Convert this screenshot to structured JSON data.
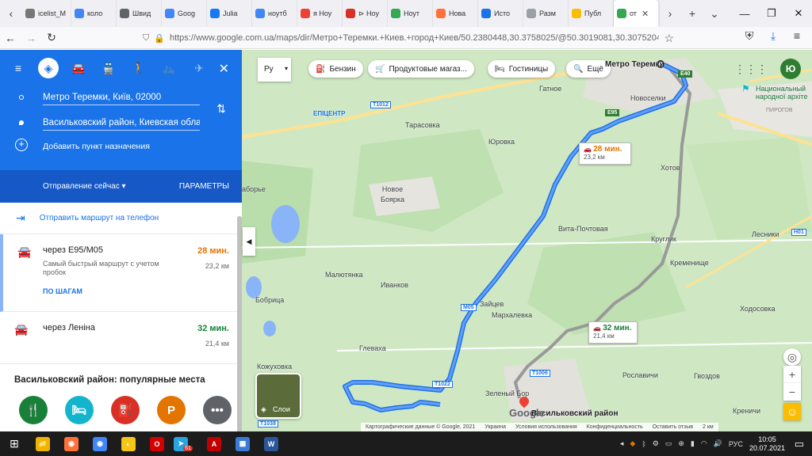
{
  "browser": {
    "tabs": [
      {
        "label": "icelist_M",
        "color": "#777777"
      },
      {
        "label": "коло",
        "color": "#4285f4"
      },
      {
        "label": "Швид",
        "color": "#5f6368"
      },
      {
        "label": "Goog",
        "color": "#4285f4"
      },
      {
        "label": "Julia",
        "color": "#1877f2"
      },
      {
        "label": "ноутб",
        "color": "#4285f4"
      },
      {
        "label": "я Ноу",
        "color": "#ea4335"
      },
      {
        "label": "⊳ Ноу",
        "color": "#d93025"
      },
      {
        "label": "Ноут",
        "color": "#34a853"
      },
      {
        "label": "Нова",
        "color": "#ff7139"
      },
      {
        "label": "Исто",
        "color": "#1a73e8"
      },
      {
        "label": "Разм",
        "color": "#9aa0a6"
      },
      {
        "label": "Публ",
        "color": "#fbbc04"
      },
      {
        "label": "от",
        "color": "#34a853"
      }
    ],
    "new_tab": "+",
    "url": "https://www.google.com.ua/maps/dir/Метро+Теремки.+Киев.+город+Киев/50.2380448,30.3758025/@50.3019081,30.3075204,"
  },
  "directions": {
    "origin": "Метро Теремки, Київ, 02000",
    "destination": "Васильковский район, Киевская обла",
    "add_destination": "Добавить пункт назначения",
    "departure": "Отправление сейчас",
    "options": "ПАРАМЕТРЫ",
    "send_to_phone": "Отправить маршрут на телефон",
    "routes": [
      {
        "name": "через E95/M05",
        "time": "28 мин.",
        "time_color": "#e37400",
        "distance": "23,2 км",
        "desc": "Самый быстрый маршрут с учетом пробок",
        "steps": "ПО ШАГАМ"
      },
      {
        "name": "через Леніна",
        "time": "32 мин.",
        "time_color": "#188038",
        "distance": "21,4 км"
      }
    ],
    "popular_title": "Васильковский район: популярные места",
    "popular_icons": [
      {
        "icon": "🍴",
        "color": "#188038"
      },
      {
        "icon": "🛏",
        "color": "#12b5cb"
      },
      {
        "icon": "⛽",
        "color": "#d93025"
      },
      {
        "icon": "P",
        "color": "#e37400"
      },
      {
        "icon": "•••",
        "color": "#5f6368"
      }
    ]
  },
  "map": {
    "language": "Ру",
    "chips": [
      "Бензин",
      "Продуктовые магаз...",
      "Гостиницы",
      "Ещё"
    ],
    "avatar": "Ю",
    "layers": "Слои",
    "callouts": [
      {
        "time": "28 мин.",
        "dist": "23,2 км",
        "color": "#e37400"
      },
      {
        "time": "32 мин.",
        "dist": "21,4 км",
        "color": "#188038"
      }
    ],
    "places": {
      "teremki": "Метро Теремки",
      "nat_park": "Национальный народної архіте",
      "pirogov": "ПИРОГОВ",
      "gatnoe": "Гатное",
      "novoselki": "Новоселки",
      "epicentr": "ЕПІЦЕНТР",
      "tarasovka": "Тарасовка",
      "yurovka": "Юровка",
      "hotov": "Хотов",
      "borie": "аборье",
      "novoe_boyarka": "Новое Боярка",
      "vita": "Вита-Почтовая",
      "kruglik": "Круглик",
      "lesniki": "Лесники",
      "kremenishe": "Кременище",
      "malyutyanka": "Малютянка",
      "ivankov": "Иванков",
      "bobritsa": "Бобрица",
      "zaytsev": "Зайцев",
      "markhalevka": "Мархалевка",
      "hodosovka": "Ходосовка",
      "glevaha": "Глеваха",
      "kozhuhovka": "Кожуховка",
      "zeleny_bor": "Зеленый Бор",
      "vasilkovsky": "Васильковский район",
      "roslavichi": "Рославичи",
      "gvozdov": "Гвоздов",
      "krenichi": "Креничи"
    },
    "roads": [
      "E40",
      "T1012",
      "E95",
      "M05",
      "T1022",
      "T1006",
      "H01",
      "T1038"
    ],
    "footer": [
      "Картографические данные © Google, 2021",
      "Украина",
      "Условия использования",
      "Конфиденциальность",
      "Оставить отзыв",
      "2 км"
    ],
    "google_logo": "Google"
  },
  "taskbar": {
    "apps": [
      {
        "icon": "📁",
        "color": "#f0b400"
      },
      {
        "icon": "◉",
        "color": "#ff7139"
      },
      {
        "icon": "◉",
        "color": "#4285f4"
      },
      {
        "icon": "◐",
        "color": "#f5c518"
      },
      {
        "icon": "O",
        "color": "#d40000"
      },
      {
        "icon": "➤",
        "color": "#2aa3e0"
      },
      {
        "icon": "A",
        "color": "#c00000"
      },
      {
        "icon": "▦",
        "color": "#3a7bd5"
      },
      {
        "icon": "W",
        "color": "#2b579a"
      }
    ],
    "telegram_badge": "61",
    "lang": "РУС",
    "time": "10:05",
    "date": "20.07.2021"
  }
}
